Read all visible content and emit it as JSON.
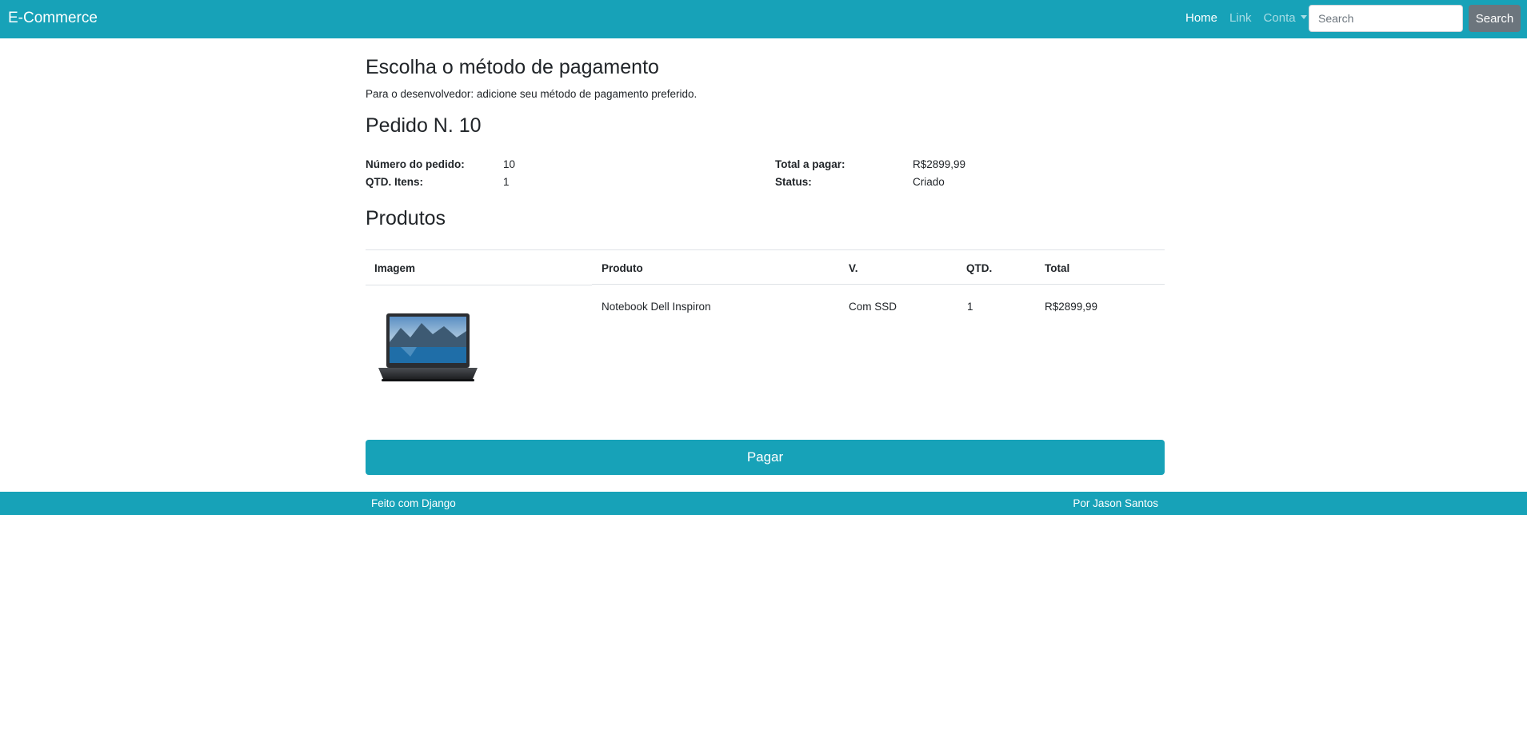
{
  "navbar": {
    "brand": "E-Commerce",
    "links": [
      {
        "label": "Home",
        "active": true
      },
      {
        "label": "Link",
        "active": false
      },
      {
        "label": "Conta",
        "active": false,
        "dropdown": true
      }
    ],
    "search_placeholder": "Search",
    "search_button": "Search"
  },
  "payment": {
    "title": "Escolha o método de pagamento",
    "dev_note": "Para o desenvolvedor: adicione seu método de pagamento preferido."
  },
  "order": {
    "title": "Pedido N. 10",
    "number_label": "Número do pedido:",
    "number_value": "10",
    "items_label": "QTD. Itens:",
    "items_value": "1",
    "total_label": "Total a pagar:",
    "total_value": "R$2899,99",
    "status_label": "Status:",
    "status_value": "Criado"
  },
  "products": {
    "title": "Produtos",
    "headers": [
      "Imagem",
      "Produto",
      "V.",
      "QTD.",
      "Total"
    ],
    "rows": [
      {
        "image": "laptop-image",
        "product": "Notebook Dell Inspiron",
        "variation": "Com SSD",
        "quantity": "1",
        "total": "R$2899,99"
      }
    ]
  },
  "pay_button": "Pagar",
  "footer": {
    "left": "Feito com Django",
    "right": "Por Jason Santos"
  },
  "colors": {
    "primary": "#17a2b8",
    "secondary": "#6c757d",
    "text": "#212529"
  }
}
